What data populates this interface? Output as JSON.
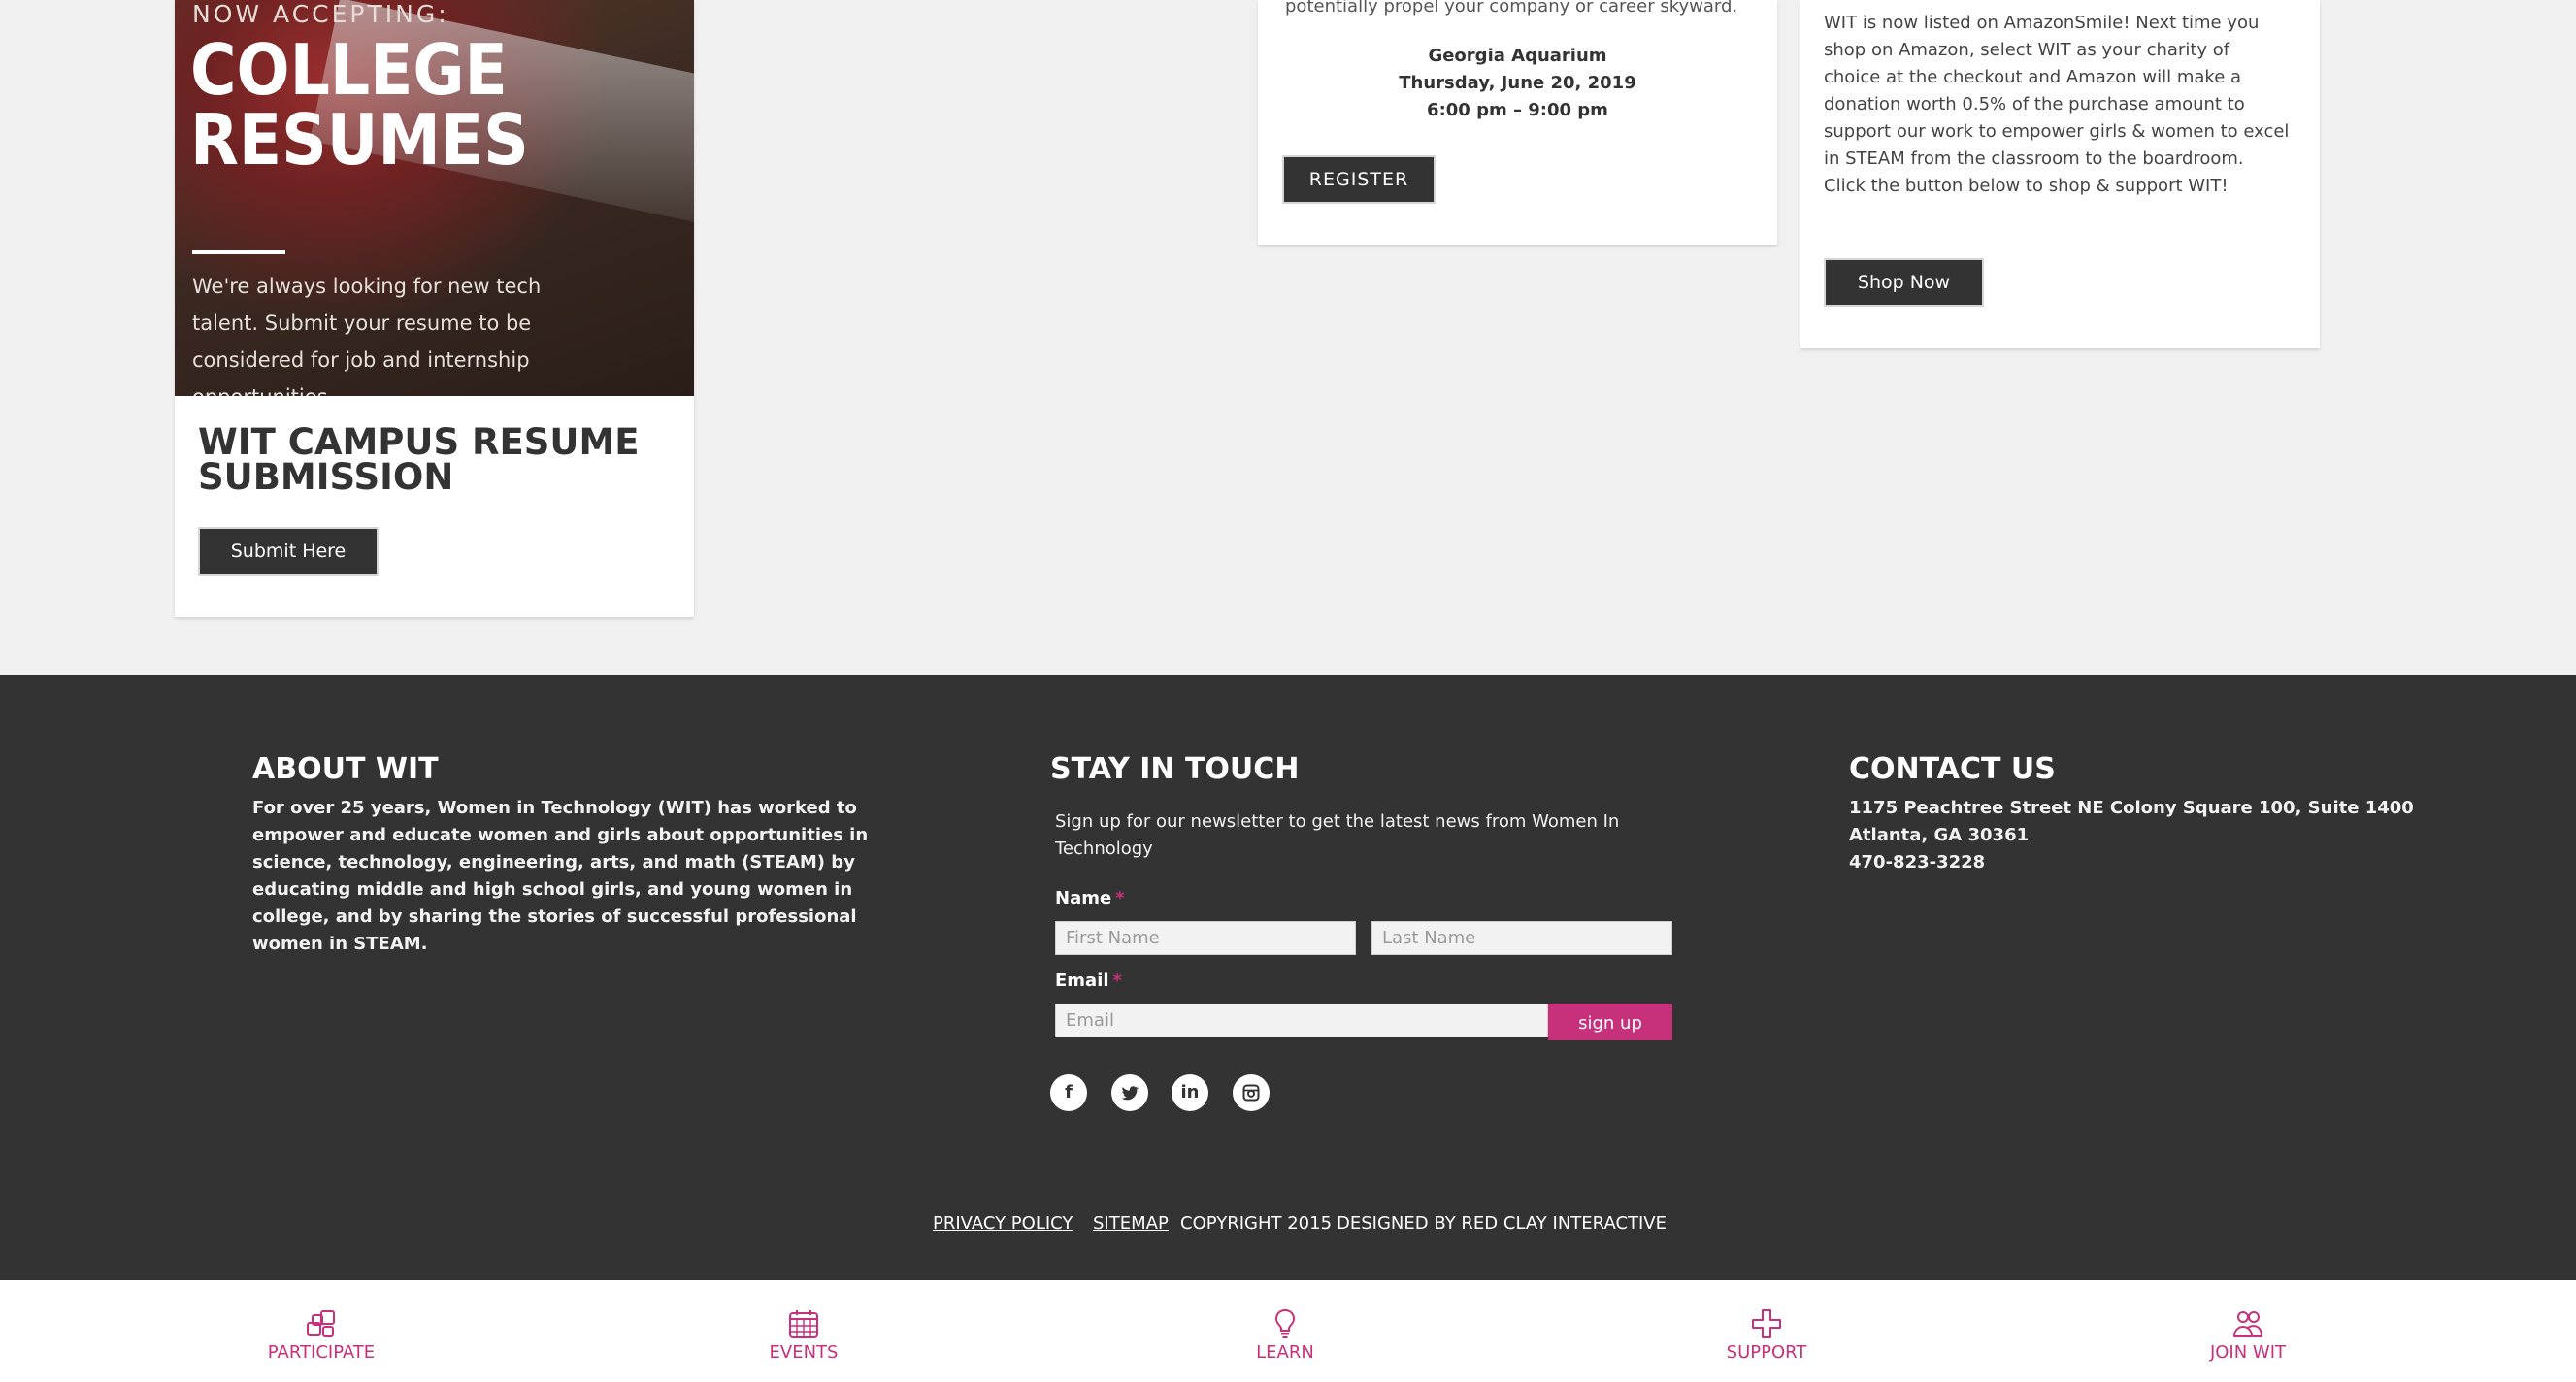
{
  "resume_card": {
    "eyebrow": "NOW ACCEPTING:",
    "title": "COLLEGE RESUMES",
    "text": "We're always looking for new tech talent. Submit your resume to be considered for job and internship opportunities.",
    "heading": "WIT CAMPUS RESUME SUBMISSION",
    "button_label": "Submit Here"
  },
  "event_card": {
    "teaser": "potentially propel your company or career skyward.",
    "venue": "Georgia Aquarium",
    "date": "Thursday, June 20, 2019",
    "time": "6:00 pm – 9:00 pm",
    "button_label": "REGISTER"
  },
  "amazon_card": {
    "text": "WIT is now listed on AmazonSmile! Next time you shop on Amazon, select WIT as your charity of choice at the checkout and Amazon will make a donation worth 0.5% of the purchase amount to support our work to empower girls & women to excel in STEAM from the classroom to the boardroom. Click the button below to shop & support WIT!",
    "button_label": "Shop Now"
  },
  "footer": {
    "about": {
      "heading": "ABOUT WIT",
      "text": "For over 25 years, Women in Technology (WIT) has worked to empower and educate women and girls about opportunities in science, technology, engineering, arts, and math (STEAM) by educating middle and high school girls, and young women in college, and by sharing the stories of successful professional women in STEAM."
    },
    "stay_in_touch": {
      "heading": "STAY IN TOUCH",
      "text": "Sign up for our newsletter to get the latest news from Women In Technology",
      "name_label": "Name",
      "email_label": "Email",
      "required_mark": "*",
      "first_name_placeholder": "First Name",
      "last_name_placeholder": "Last Name",
      "email_placeholder": "Email",
      "signup_label": "sign up",
      "social": [
        {
          "name": "facebook-icon",
          "glyph": "f"
        },
        {
          "name": "twitter-icon",
          "glyph": ""
        },
        {
          "name": "linkedin-icon",
          "glyph": "in"
        },
        {
          "name": "instagram-icon",
          "glyph": ""
        }
      ]
    },
    "contact": {
      "heading": "CONTACT US",
      "address_line1": "1175 Peachtree Street NE Colony Square 100, Suite 1400",
      "address_line2": "Atlanta, GA 30361",
      "phone": "470-823-3228"
    },
    "legal": {
      "privacy": "PRIVACY POLICY",
      "sitemap": "SITEMAP",
      "copyright": "COPYRIGHT 2015",
      "designed_by": "DESIGNED BY RED CLAY INTERACTIVE"
    }
  },
  "bottom_nav": {
    "items": [
      {
        "label": "PARTICIPATE",
        "icon": "participate-icon"
      },
      {
        "label": "EVENTS",
        "icon": "calendar-icon"
      },
      {
        "label": "LEARN",
        "icon": "lightbulb-icon"
      },
      {
        "label": "SUPPORT",
        "icon": "plus-icon"
      },
      {
        "label": "JOIN WIT",
        "icon": "people-icon"
      }
    ]
  },
  "colors": {
    "accent": "#c7317c",
    "footer_bg": "#333333",
    "page_bg": "#f0f0f0",
    "button_dark": "#333333"
  }
}
